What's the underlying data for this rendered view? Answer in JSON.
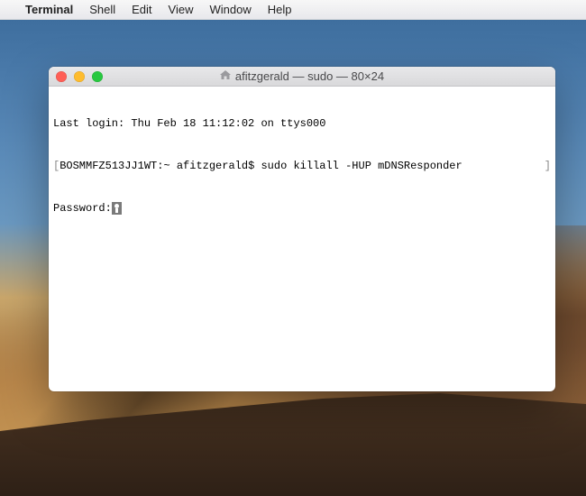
{
  "menubar": {
    "app_name": "Terminal",
    "items": [
      "Shell",
      "Edit",
      "View",
      "Window",
      "Help"
    ]
  },
  "window": {
    "title": "afitzgerald — sudo — 80×24"
  },
  "terminal": {
    "last_login": "Last login: Thu Feb 18 11:12:02 on ttys000",
    "hostname": "BOSMMFZ513JJ1WT",
    "cwd": "~",
    "user": "afitzgerald",
    "prompt_symbol": "$",
    "command": "sudo killall -HUP mDNSResponder",
    "password_prompt": "Password:"
  }
}
